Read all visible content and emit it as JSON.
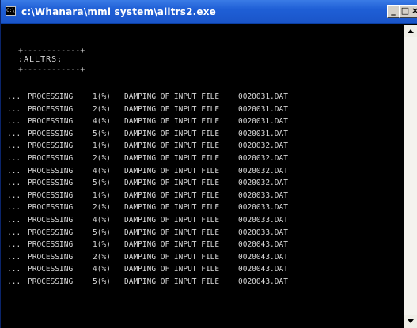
{
  "window": {
    "title": "c:\\Whanara\\mmi system\\alltrs2.exe",
    "app_icon_glyph": "C:\\",
    "buttons": {
      "minimize": "_",
      "maximize": "□",
      "close": "×"
    }
  },
  "console": {
    "box_top": "+------------+",
    "box_label": ":ALLTRS:",
    "box_bottom": "+------------+",
    "lines": [
      {
        "prefix": "...",
        "verb": "PROCESSING",
        "step": "1(%)",
        "message": "DAMPING OF INPUT FILE",
        "file": "0020031.DAT"
      },
      {
        "prefix": "...",
        "verb": "PROCESSING",
        "step": "2(%)",
        "message": "DAMPING OF INPUT FILE",
        "file": "0020031.DAT"
      },
      {
        "prefix": "...",
        "verb": "PROCESSING",
        "step": "4(%)",
        "message": "DAMPING OF INPUT FILE",
        "file": "0020031.DAT"
      },
      {
        "prefix": "...",
        "verb": "PROCESSING",
        "step": "5(%)",
        "message": "DAMPING OF INPUT FILE",
        "file": "0020031.DAT"
      },
      {
        "prefix": "...",
        "verb": "PROCESSING",
        "step": "1(%)",
        "message": "DAMPING OF INPUT FILE",
        "file": "0020032.DAT"
      },
      {
        "prefix": "...",
        "verb": "PROCESSING",
        "step": "2(%)",
        "message": "DAMPING OF INPUT FILE",
        "file": "0020032.DAT"
      },
      {
        "prefix": "...",
        "verb": "PROCESSING",
        "step": "4(%)",
        "message": "DAMPING OF INPUT FILE",
        "file": "0020032.DAT"
      },
      {
        "prefix": "...",
        "verb": "PROCESSING",
        "step": "5(%)",
        "message": "DAMPING OF INPUT FILE",
        "file": "0020032.DAT"
      },
      {
        "prefix": "...",
        "verb": "PROCESSING",
        "step": "1(%)",
        "message": "DAMPING OF INPUT FILE",
        "file": "0020033.DAT"
      },
      {
        "prefix": "...",
        "verb": "PROCESSING",
        "step": "2(%)",
        "message": "DAMPING OF INPUT FILE",
        "file": "0020033.DAT"
      },
      {
        "prefix": "...",
        "verb": "PROCESSING",
        "step": "4(%)",
        "message": "DAMPING OF INPUT FILE",
        "file": "0020033.DAT"
      },
      {
        "prefix": "...",
        "verb": "PROCESSING",
        "step": "5(%)",
        "message": "DAMPING OF INPUT FILE",
        "file": "0020033.DAT"
      },
      {
        "prefix": "...",
        "verb": "PROCESSING",
        "step": "1(%)",
        "message": "DAMPING OF INPUT FILE",
        "file": "0020043.DAT"
      },
      {
        "prefix": "...",
        "verb": "PROCESSING",
        "step": "2(%)",
        "message": "DAMPING OF INPUT FILE",
        "file": "0020043.DAT"
      },
      {
        "prefix": "...",
        "verb": "PROCESSING",
        "step": "4(%)",
        "message": "DAMPING OF INPUT FILE",
        "file": "0020043.DAT"
      },
      {
        "prefix": "...",
        "verb": "PROCESSING",
        "step": "5(%)",
        "message": "DAMPING OF INPUT FILE",
        "file": "0020043.DAT"
      }
    ]
  },
  "colors": {
    "titlebar": "#1f5fd6",
    "console_bg": "#000000",
    "console_text": "#d8d8d8"
  }
}
